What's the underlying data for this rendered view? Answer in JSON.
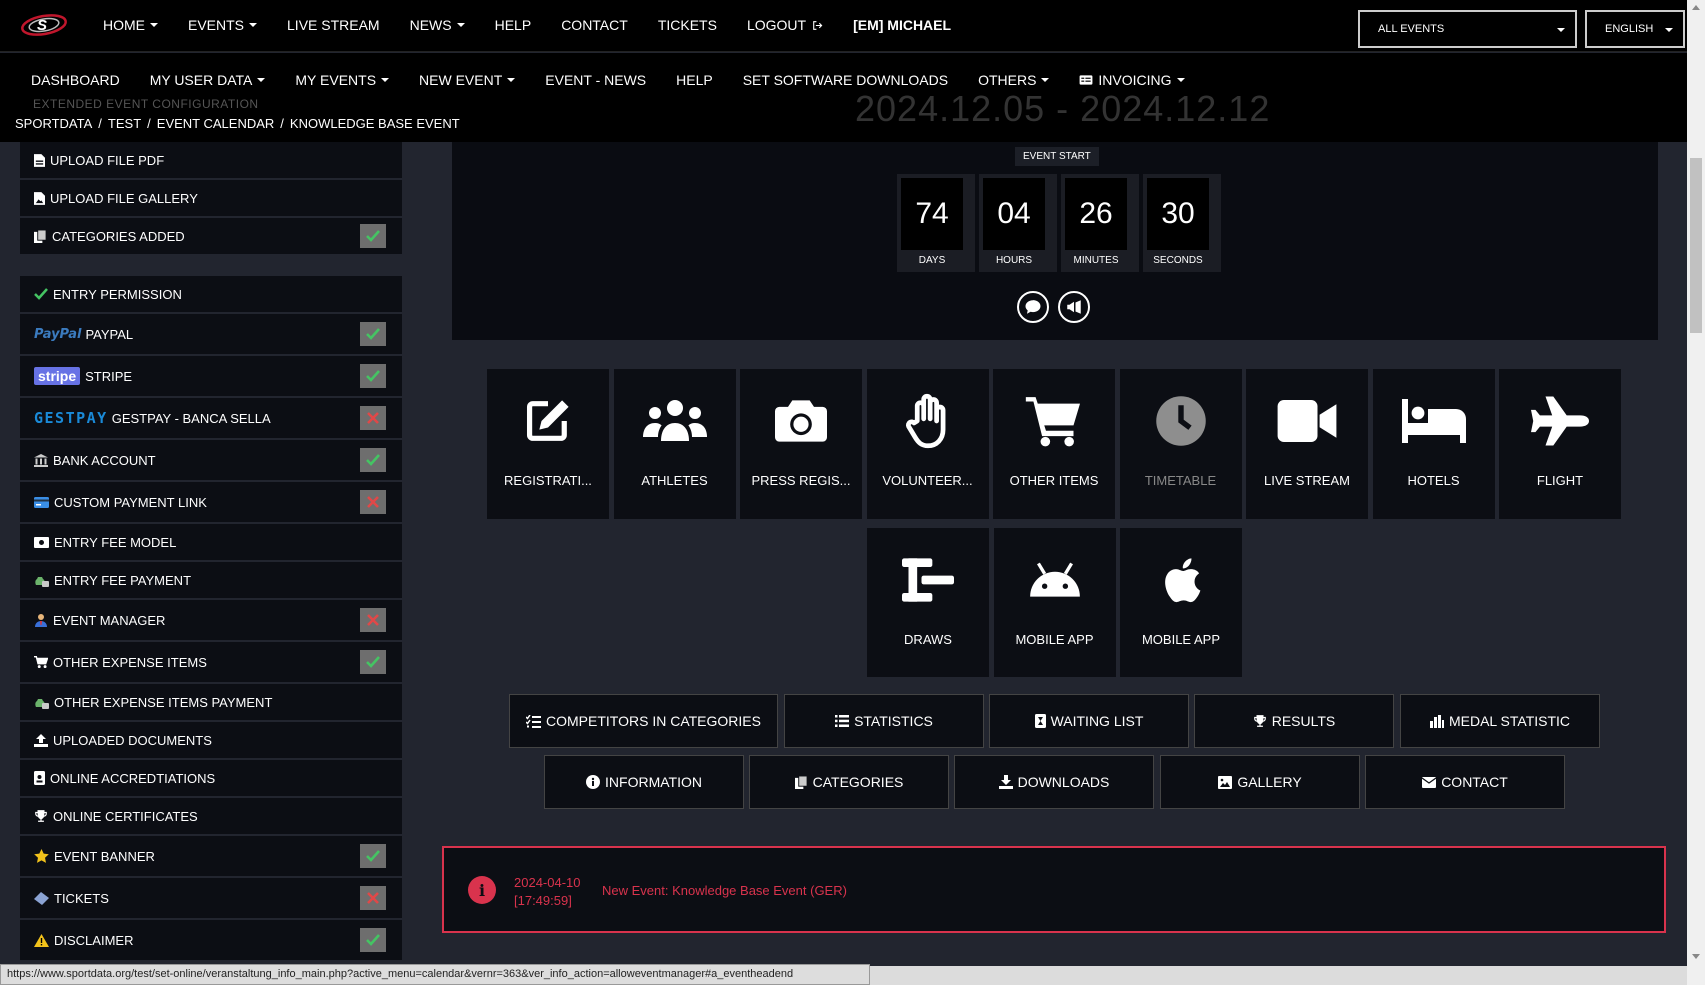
{
  "topnav": {
    "items": [
      {
        "label": "HOME",
        "dropdown": true
      },
      {
        "label": "EVENTS",
        "dropdown": true
      },
      {
        "label": "LIVE STREAM",
        "dropdown": false
      },
      {
        "label": "NEWS",
        "dropdown": true
      },
      {
        "label": "HELP",
        "dropdown": false
      },
      {
        "label": "CONTACT",
        "dropdown": false
      },
      {
        "label": "TICKETS",
        "dropdown": false
      },
      {
        "label": "LOGOUT",
        "dropdown": false,
        "icon": "logout-icon"
      }
    ],
    "user": "[EM] MICHAEL",
    "events_select": "ALL EVENTS",
    "language_select": "ENGLISH"
  },
  "subnav": {
    "items": [
      {
        "label": "DASHBOARD",
        "dropdown": false
      },
      {
        "label": "MY USER DATA",
        "dropdown": true
      },
      {
        "label": "MY EVENTS",
        "dropdown": true
      },
      {
        "label": "NEW EVENT",
        "dropdown": true
      },
      {
        "label": "EVENT - NEWS",
        "dropdown": false
      },
      {
        "label": "HELP",
        "dropdown": false
      },
      {
        "label": "SET SOFTWARE DOWNLOADS",
        "dropdown": false
      },
      {
        "label": "OTHERS",
        "dropdown": true
      },
      {
        "label": "INVOICING",
        "dropdown": true,
        "icon": "invoice-icon"
      }
    ]
  },
  "breadcrumb": [
    "SPORTDATA",
    "TEST",
    "EVENT CALENDAR",
    "KNOWLEDGE BASE EVENT"
  ],
  "partial_header": {
    "sidebar_item": "EXTENDED EVENT CONFIGURATION",
    "date_range": "2024.12.05 - 2024.12.12"
  },
  "sidebar": [
    {
      "label": "UPLOAD FILE PDF",
      "icon": "file-pdf-icon",
      "status": null
    },
    {
      "label": "UPLOAD FILE GALLERY",
      "icon": "file-image-icon",
      "status": null
    },
    {
      "label": "CATEGORIES ADDED",
      "icon": "copy-icon",
      "status": "ok"
    },
    {
      "label": "ENTRY PERMISSION",
      "icon": "check-mark-icon",
      "status": null,
      "gap_before": true
    },
    {
      "label": "PAYPAL",
      "icon": "paypal-logo",
      "brand": "PayPal",
      "status": "ok"
    },
    {
      "label": "STRIPE",
      "icon": "stripe-logo",
      "brand": "stripe",
      "status": "ok"
    },
    {
      "label": "GESTPAY - BANCA SELLA",
      "icon": "gestpay-logo",
      "brand": "GESTPAY",
      "status": "missing"
    },
    {
      "label": "BANK ACCOUNT",
      "icon": "bank-icon",
      "status": "ok"
    },
    {
      "label": "CUSTOM PAYMENT LINK",
      "icon": "credit-card-icon",
      "status": "missing"
    },
    {
      "label": "ENTRY FEE MODEL",
      "icon": "money-icon",
      "status": null
    },
    {
      "label": "ENTRY FEE PAYMENT",
      "icon": "money-bag-icon",
      "status": null
    },
    {
      "label": "EVENT MANAGER",
      "icon": "user-tie-icon",
      "status": "missing"
    },
    {
      "label": "OTHER EXPENSE ITEMS",
      "icon": "shopping-cart-icon",
      "status": "ok"
    },
    {
      "label": "OTHER EXPENSE ITEMS PAYMENT",
      "icon": "money-bag-icon",
      "status": null
    },
    {
      "label": "UPLOADED DOCUMENTS",
      "icon": "upload-icon",
      "status": null
    },
    {
      "label": "ONLINE ACCREDTIATIONS",
      "icon": "id-badge-icon",
      "status": null
    },
    {
      "label": "ONLINE CERTIFICATES",
      "icon": "trophy-icon",
      "status": null
    },
    {
      "label": "EVENT BANNER",
      "icon": "star-icon",
      "status": "ok"
    },
    {
      "label": "TICKETS",
      "icon": "ticket-icon",
      "status": "missing"
    },
    {
      "label": "DISCLAIMER",
      "icon": "warning-icon",
      "status": "ok"
    }
  ],
  "countdown": {
    "title": "EVENT START",
    "units": [
      {
        "value": "74",
        "label": "DAYS"
      },
      {
        "value": "04",
        "label": "HOURS"
      },
      {
        "value": "26",
        "label": "MINUTES"
      },
      {
        "value": "30",
        "label": "SECONDS"
      }
    ]
  },
  "tiles_row1": [
    {
      "label": "REGISTRATI...",
      "icon": "edit-icon",
      "dim": false
    },
    {
      "label": "ATHLETES",
      "icon": "users-icon",
      "dim": false
    },
    {
      "label": "PRESS REGIS...",
      "icon": "camera-icon",
      "dim": false
    },
    {
      "label": "VOLUNTEER...",
      "icon": "hand-icon",
      "dim": false
    },
    {
      "label": "OTHER ITEMS",
      "icon": "shopping-cart-icon",
      "dim": false
    },
    {
      "label": "TIMETABLE",
      "icon": "clock-icon",
      "dim": true
    },
    {
      "label": "LIVE STREAM",
      "icon": "video-camera-icon",
      "dim": false
    },
    {
      "label": "HOTELS",
      "icon": "bed-icon",
      "dim": false
    },
    {
      "label": "FLIGHT",
      "icon": "plane-icon",
      "dim": false
    }
  ],
  "tiles_row2": [
    {
      "label": "DRAWS",
      "icon": "draws-icon",
      "dim": false
    },
    {
      "label": "MOBILE APP",
      "icon": "android-icon",
      "dim": false
    },
    {
      "label": "MOBILE APP",
      "icon": "apple-icon",
      "dim": false
    }
  ],
  "buttons_row1": [
    {
      "label": "COMPETITORS IN CATEGORIES",
      "icon": "list-check-icon"
    },
    {
      "label": "STATISTICS",
      "icon": "list-icon"
    },
    {
      "label": "WAITING LIST",
      "icon": "hourglass-icon"
    },
    {
      "label": "RESULTS",
      "icon": "trophy-icon"
    },
    {
      "label": "MEDAL STATISTIC",
      "icon": "bar-chart-icon"
    }
  ],
  "buttons_row2": [
    {
      "label": "INFORMATION",
      "icon": "info-icon"
    },
    {
      "label": "CATEGORIES",
      "icon": "copy-icon"
    },
    {
      "label": "DOWNLOADS",
      "icon": "download-icon"
    },
    {
      "label": "GALLERY",
      "icon": "image-icon"
    },
    {
      "label": "CONTACT",
      "icon": "envelope-icon"
    }
  ],
  "alert": {
    "date": "2024-04-10",
    "time": "[17:49:59]",
    "message": "New Event: Knowledge Base Event (GER)",
    "color": "#d9334d"
  },
  "statusbar": {
    "url": "https://www.sportdata.org/test/set-online/veranstaltung_info_main.php?active_menu=calendar&vernr=363&ver_info_action=alloweventmanager#a_eventheadend"
  },
  "colors": {
    "background": "#22252f",
    "panel": "#0c0e14",
    "nav": "#000000",
    "ok": "#6e6e6e",
    "ok_mark": "#45c463",
    "missing_mark": "#e04848"
  }
}
